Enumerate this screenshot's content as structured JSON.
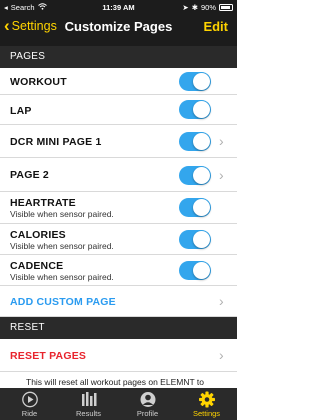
{
  "status_bar": {
    "carrier": "Search",
    "time": "11:39 AM",
    "battery": "90%"
  },
  "nav": {
    "back_label": "Settings",
    "title": "Customize Pages",
    "edit_label": "Edit"
  },
  "sections": {
    "pages_header": "PAGES",
    "reset_header": "RESET"
  },
  "pages": [
    {
      "label": "WORKOUT",
      "enabled": true
    },
    {
      "label": "LAP",
      "enabled": true
    },
    {
      "label": "DCR MINI PAGE 1",
      "enabled": true
    },
    {
      "label": "PAGE 2",
      "enabled": true
    },
    {
      "label": "HEARTRATE",
      "sub": "Visible when sensor paired.",
      "enabled": true
    },
    {
      "label": "CALORIES",
      "sub": "Visible when sensor paired.",
      "enabled": true
    },
    {
      "label": "CADENCE",
      "sub": "Visible when sensor paired.",
      "enabled": true
    }
  ],
  "add_custom_page": "ADD CUSTOM PAGE",
  "reset_pages": "RESET PAGES",
  "reset_note": "This will reset all workout pages on ELEMNT to",
  "tabs": [
    {
      "label": "Ride",
      "active": false
    },
    {
      "label": "Results",
      "active": false
    },
    {
      "label": "Profile",
      "active": false
    },
    {
      "label": "Settings",
      "active": true
    }
  ],
  "colors": {
    "header_bg": "#1c1c1c",
    "accent": "#ffd400",
    "toggle_on": "#33a6ed",
    "link": "#2a9bf0",
    "danger": "#e8242d"
  }
}
